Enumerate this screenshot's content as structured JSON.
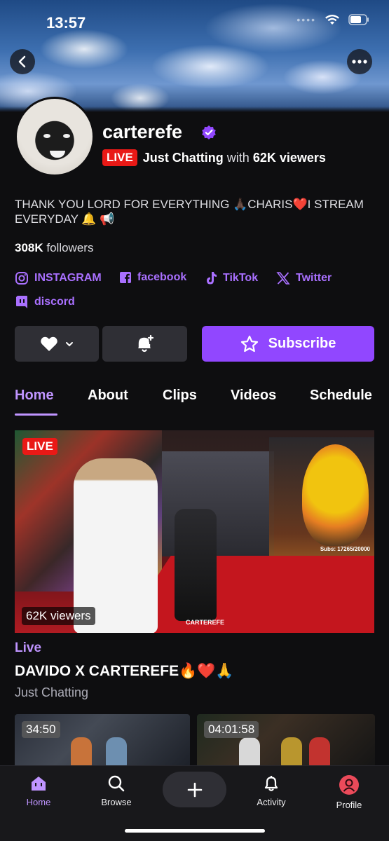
{
  "status_bar": {
    "time": "13:57"
  },
  "channel": {
    "username": "carterefe",
    "live_badge": "LIVE",
    "category": "Just Chatting",
    "with_text": "with",
    "viewers": "62K viewers",
    "bio": "THANK YOU LORD FOR EVERYTHING 🙏🏿CHARIS❤️I STREAM EVERYDAY 🔔 📢",
    "followers_count": "308K",
    "followers_label": "followers"
  },
  "socials": [
    {
      "label": "INSTAGRAM",
      "icon": "instagram-icon"
    },
    {
      "label": "facebook",
      "icon": "facebook-icon"
    },
    {
      "label": "TikTok",
      "icon": "tiktok-icon"
    },
    {
      "label": "Twitter",
      "icon": "x-icon"
    },
    {
      "label": "discord",
      "icon": "discord-icon"
    }
  ],
  "actions": {
    "subscribe_label": "Subscribe"
  },
  "tabs": [
    {
      "label": "Home",
      "active": true
    },
    {
      "label": "About"
    },
    {
      "label": "Clips"
    },
    {
      "label": "Videos"
    },
    {
      "label": "Schedule"
    }
  ],
  "live_card": {
    "badge": "LIVE",
    "viewers": "62K viewers",
    "overlay_subs": "Subs: 17265/20000",
    "watermark": "CARTEREFE",
    "section_label": "Live",
    "title": "DAVIDO X CARTEREFE🔥❤️🙏",
    "category": "Just Chatting"
  },
  "videos": [
    {
      "duration": "34:50"
    },
    {
      "duration": "04:01:58"
    }
  ],
  "bottom_nav": [
    {
      "label": "Home",
      "active": true
    },
    {
      "label": "Browse"
    },
    {
      "label": "Activity"
    },
    {
      "label": "Profile"
    }
  ],
  "colors": {
    "accent": "#9147ff",
    "accent_light": "#bf94ff",
    "live_red": "#e91916",
    "background": "#0e0e10"
  }
}
